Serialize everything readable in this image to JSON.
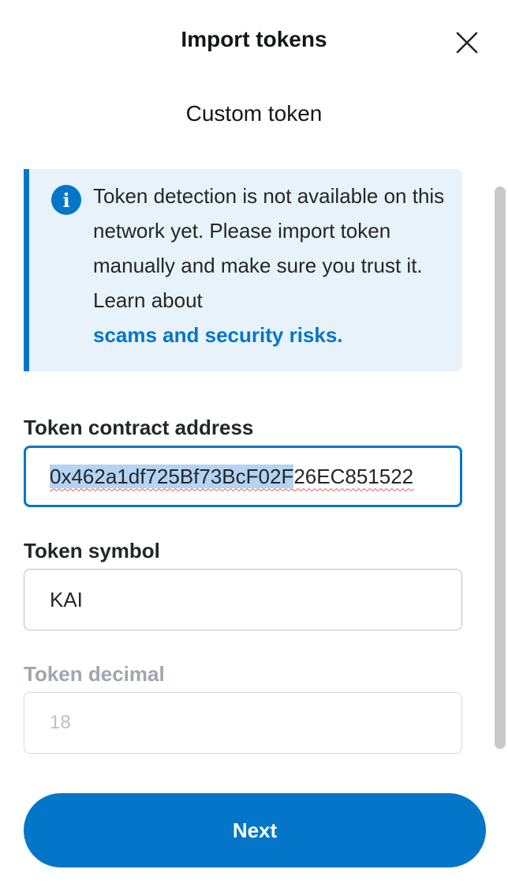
{
  "header": {
    "title": "Import tokens",
    "close_icon": "close-icon"
  },
  "tabs": {
    "active": "Custom token"
  },
  "notice": {
    "icon": "info-icon",
    "icon_glyph": "i",
    "text": "Token detection is not available on this network yet. Please import token manually and make sure you trust it. Learn about",
    "link": "scams and security risks.",
    "accent_color": "#0376c9"
  },
  "form": {
    "contract_address": {
      "label": "Token contract address",
      "value_selected": "0x462a1df725Bf73BcF02F",
      "value_rest": "26EC851522"
    },
    "symbol": {
      "label": "Token symbol",
      "value": "KAI"
    },
    "decimal": {
      "label": "Token decimal",
      "value": "18"
    }
  },
  "footer": {
    "next_label": "Next"
  }
}
